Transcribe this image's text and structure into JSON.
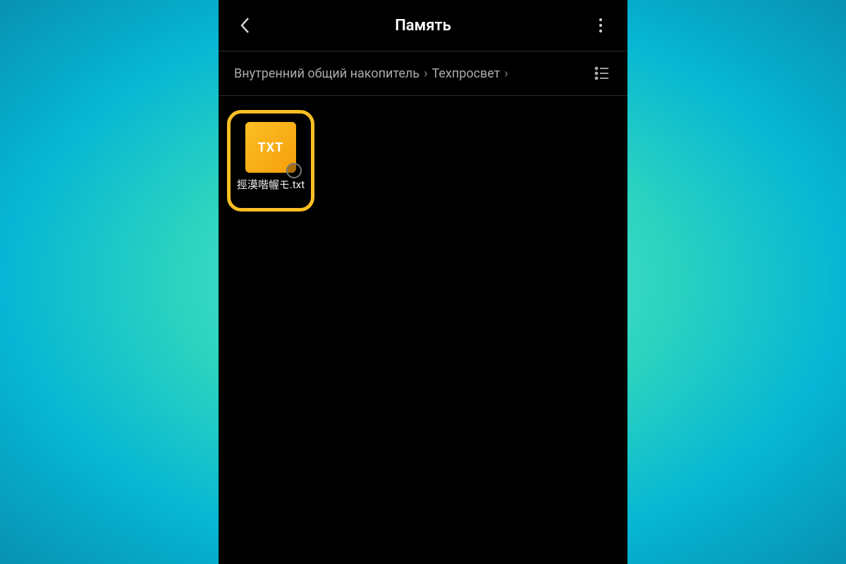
{
  "header": {
    "title": "Память"
  },
  "breadcrumb": {
    "item1": "Внутренний общий накопитель",
    "item2": "Техпросвет"
  },
  "files": [
    {
      "icon_label": "TXT",
      "name": "挳漠喈幄モ.txt"
    }
  ],
  "colors": {
    "highlight": "#FBBF24",
    "icon_bg": "#F59E0B"
  }
}
